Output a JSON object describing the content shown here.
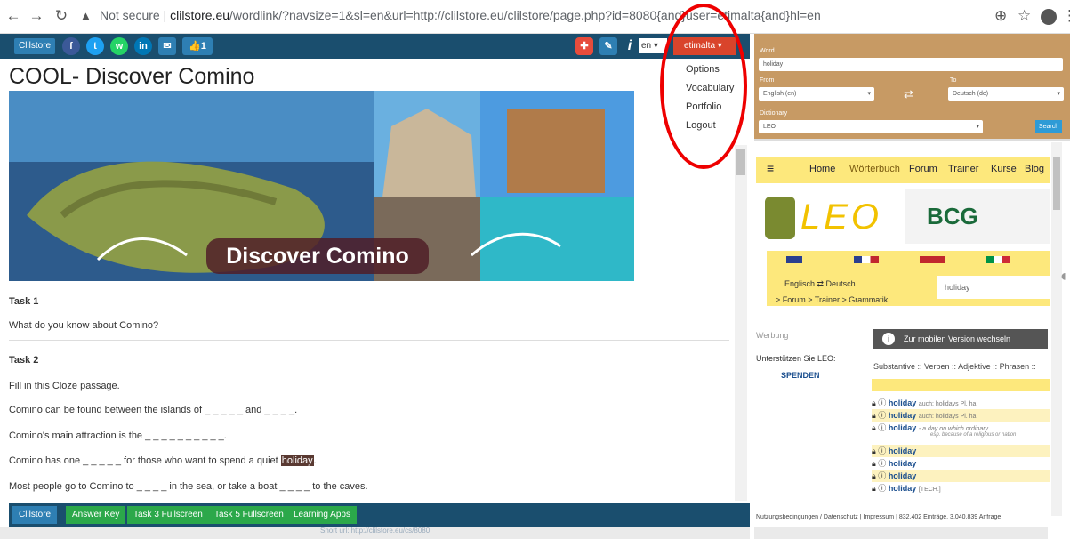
{
  "browser": {
    "security": "Not secure",
    "url_host": "clilstore.eu",
    "url_path": "/wordlink/?navsize=1&sl=en&url=http://clilstore.eu/clilstore/page.php?id=8080{and}user=etimalta{and}hl=en"
  },
  "topbar": {
    "brand": "Clilstore",
    "like_count": "1",
    "lang": "en",
    "user": "etimalta"
  },
  "user_menu": [
    "Options",
    "Vocabulary",
    "Portfolio",
    "Logout"
  ],
  "page": {
    "title": "COOL- Discover Comino",
    "banner_text": "Discover Comino",
    "task1": "Task 1",
    "task1_q": "What do you know about Comino?",
    "task2": "Task 2",
    "task2_instr": "Fill in this Cloze passage.",
    "line1": "Comino can be found between the islands of _ _ _ _ _ and _ _ _ _.",
    "line2": "Comino's main attraction is the _ _ _ _ _ _ _ _ _ _.",
    "line3_a": "Comino has one _ _ _ _ _ for those who want to spend a quiet ",
    "line3_hl": "holiday",
    "line3_b": ".",
    "line4": "Most people go to Comino to _ _ _ _ in the sea, or take a boat _ _ _ _ to the caves."
  },
  "bottombar": {
    "buttons": [
      "Clilstore",
      "Answer Key",
      "Task 3 Fullscreen",
      "Task 5 Fullscreen",
      "Learning Apps"
    ],
    "short_url": "Short url:  http://clilstore.eu/cs/8080"
  },
  "dict": {
    "word_label": "Word",
    "word_value": "holiday",
    "from_label": "From",
    "from_value": "English (en)",
    "to_label": "To",
    "to_value": "Deutsch (de)",
    "dictionary_label": "Dictionary",
    "dictionary_value": "LEO",
    "search": "Search"
  },
  "leo": {
    "nav": [
      "Home",
      "Wörterbuch",
      "Forum",
      "Trainer",
      "Kurse",
      "Blog"
    ],
    "logo": "LEO",
    "ad": "BCG",
    "lang_pair": "Englisch ⇄ Deutsch",
    "search_value": "holiday",
    "sublinks": "> Forum > Trainer > Grammatik",
    "werbung": "Werbung",
    "mobile": "Zur mobilen Version wechseln",
    "support": "Unterstützen Sie LEO:",
    "spenden": "SPENDEN",
    "categories": "Substantive :: Verben :: Adjektive :: Phrasen ::",
    "entries": [
      {
        "word": "holiday",
        "extra": "auch: holidays  Pl.  ha"
      },
      {
        "word": "holiday",
        "extra": "auch: holidays  Pl.  ha"
      },
      {
        "word": "holiday",
        "extra": "- a day on which ordinary"
      },
      {
        "word": "holiday",
        "extra": ""
      },
      {
        "word": "holiday",
        "extra": ""
      },
      {
        "word": "holiday",
        "extra": ""
      },
      {
        "word": "holiday",
        "extra": "[TECH.]"
      }
    ],
    "entry_note": "esp. because of a religious or nation",
    "footer": "Nutzungsbedingungen / Datenschutz | Impressum | 832,402 Einträge, 3,040,839 Anfrage"
  }
}
